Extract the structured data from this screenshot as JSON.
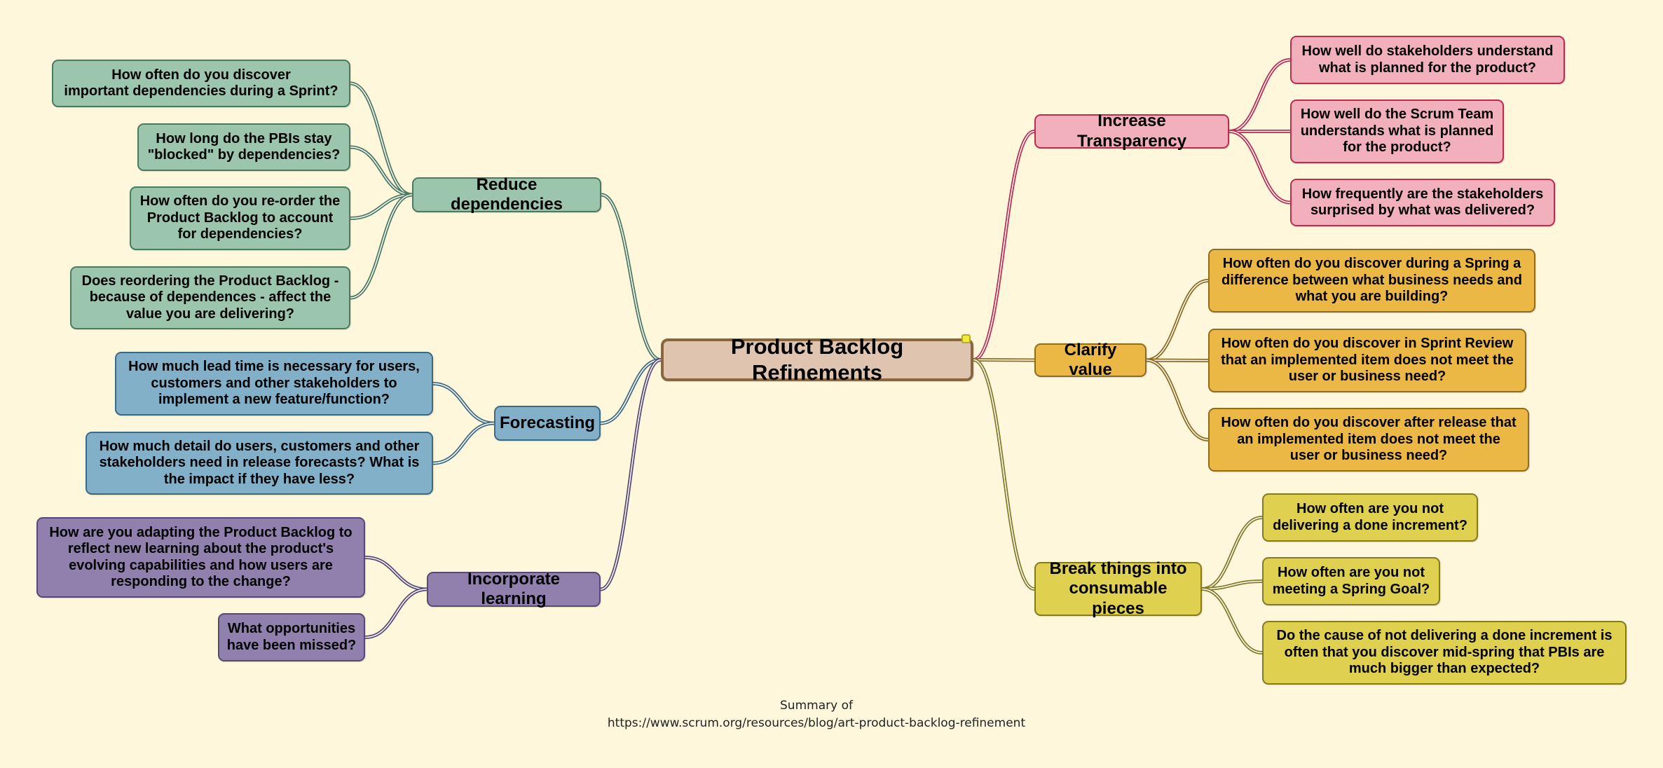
{
  "root": {
    "label": "Product Backlog Refinements"
  },
  "branches": {
    "reduce_dependencies": {
      "label": "Reduce dependencies",
      "color": "#4c7a5e",
      "leaves": [
        "How often do you discover\nimportant dependencies during a Sprint?",
        "How long do the PBIs stay\n\"blocked\" by dependencies?",
        "How often do you re-order the\nProduct Backlog to account\nfor dependencies?",
        "Does reordering the Product Backlog -\nbecause of dependences - affect the\nvalue you are delivering?"
      ]
    },
    "forecasting": {
      "label": "Forecasting",
      "color": "#3d6a82",
      "leaves": [
        "How much lead time is necessary for users,\ncustomers and other stakeholders to\nimplement a new feature/function?",
        "How much detail do users, customers and other\nstakeholders need in release forecasts? What is\nthe impact if they have less?"
      ]
    },
    "incorporate_learning": {
      "label": "Incorporate learning",
      "color": "#574974",
      "leaves": [
        "How are you adapting the Product Backlog to\nreflect new learning about the product's\nevolving capabilities and how users are\nresponding to the change?",
        "What opportunities\nhave been missed?"
      ]
    },
    "increase_transparency": {
      "label": "Increase Transparency",
      "color": "#bd2c4f",
      "leaves": [
        "How well do stakeholders understand\nwhat is planned for the product?",
        "How well do the Scrum Team\nunderstands what is planned\nfor the product?",
        "How frequently are the stakeholders\nsurprised by what was delivered?"
      ]
    },
    "clarify_value": {
      "label": "Clarify value",
      "color": "#8f6c1e",
      "leaves": [
        "How often do you discover during a Spring a\ndifference between what business needs and\nwhat you are building?",
        "How often do you discover in Sprint Review\nthat an implemented item does not meet the\nuser or business need?",
        "How often do you discover after release that\nan implemented item does not meet the\nuser or business need?"
      ]
    },
    "break_things": {
      "label": "Break things into\nconsumable pieces",
      "color": "#857a24",
      "leaves": [
        "How often are you not\ndelivering a done increment?",
        "How often are you not\nmeeting a Spring Goal?",
        "Do the cause of not delivering a done increment is\noften that you discover mid-spring that PBIs are\nmuch bigger than expected?"
      ]
    }
  },
  "caption": {
    "line1": "Summary of",
    "line2": "https://www.scrum.org/resources/blog/art-product-backlog-refinement"
  }
}
